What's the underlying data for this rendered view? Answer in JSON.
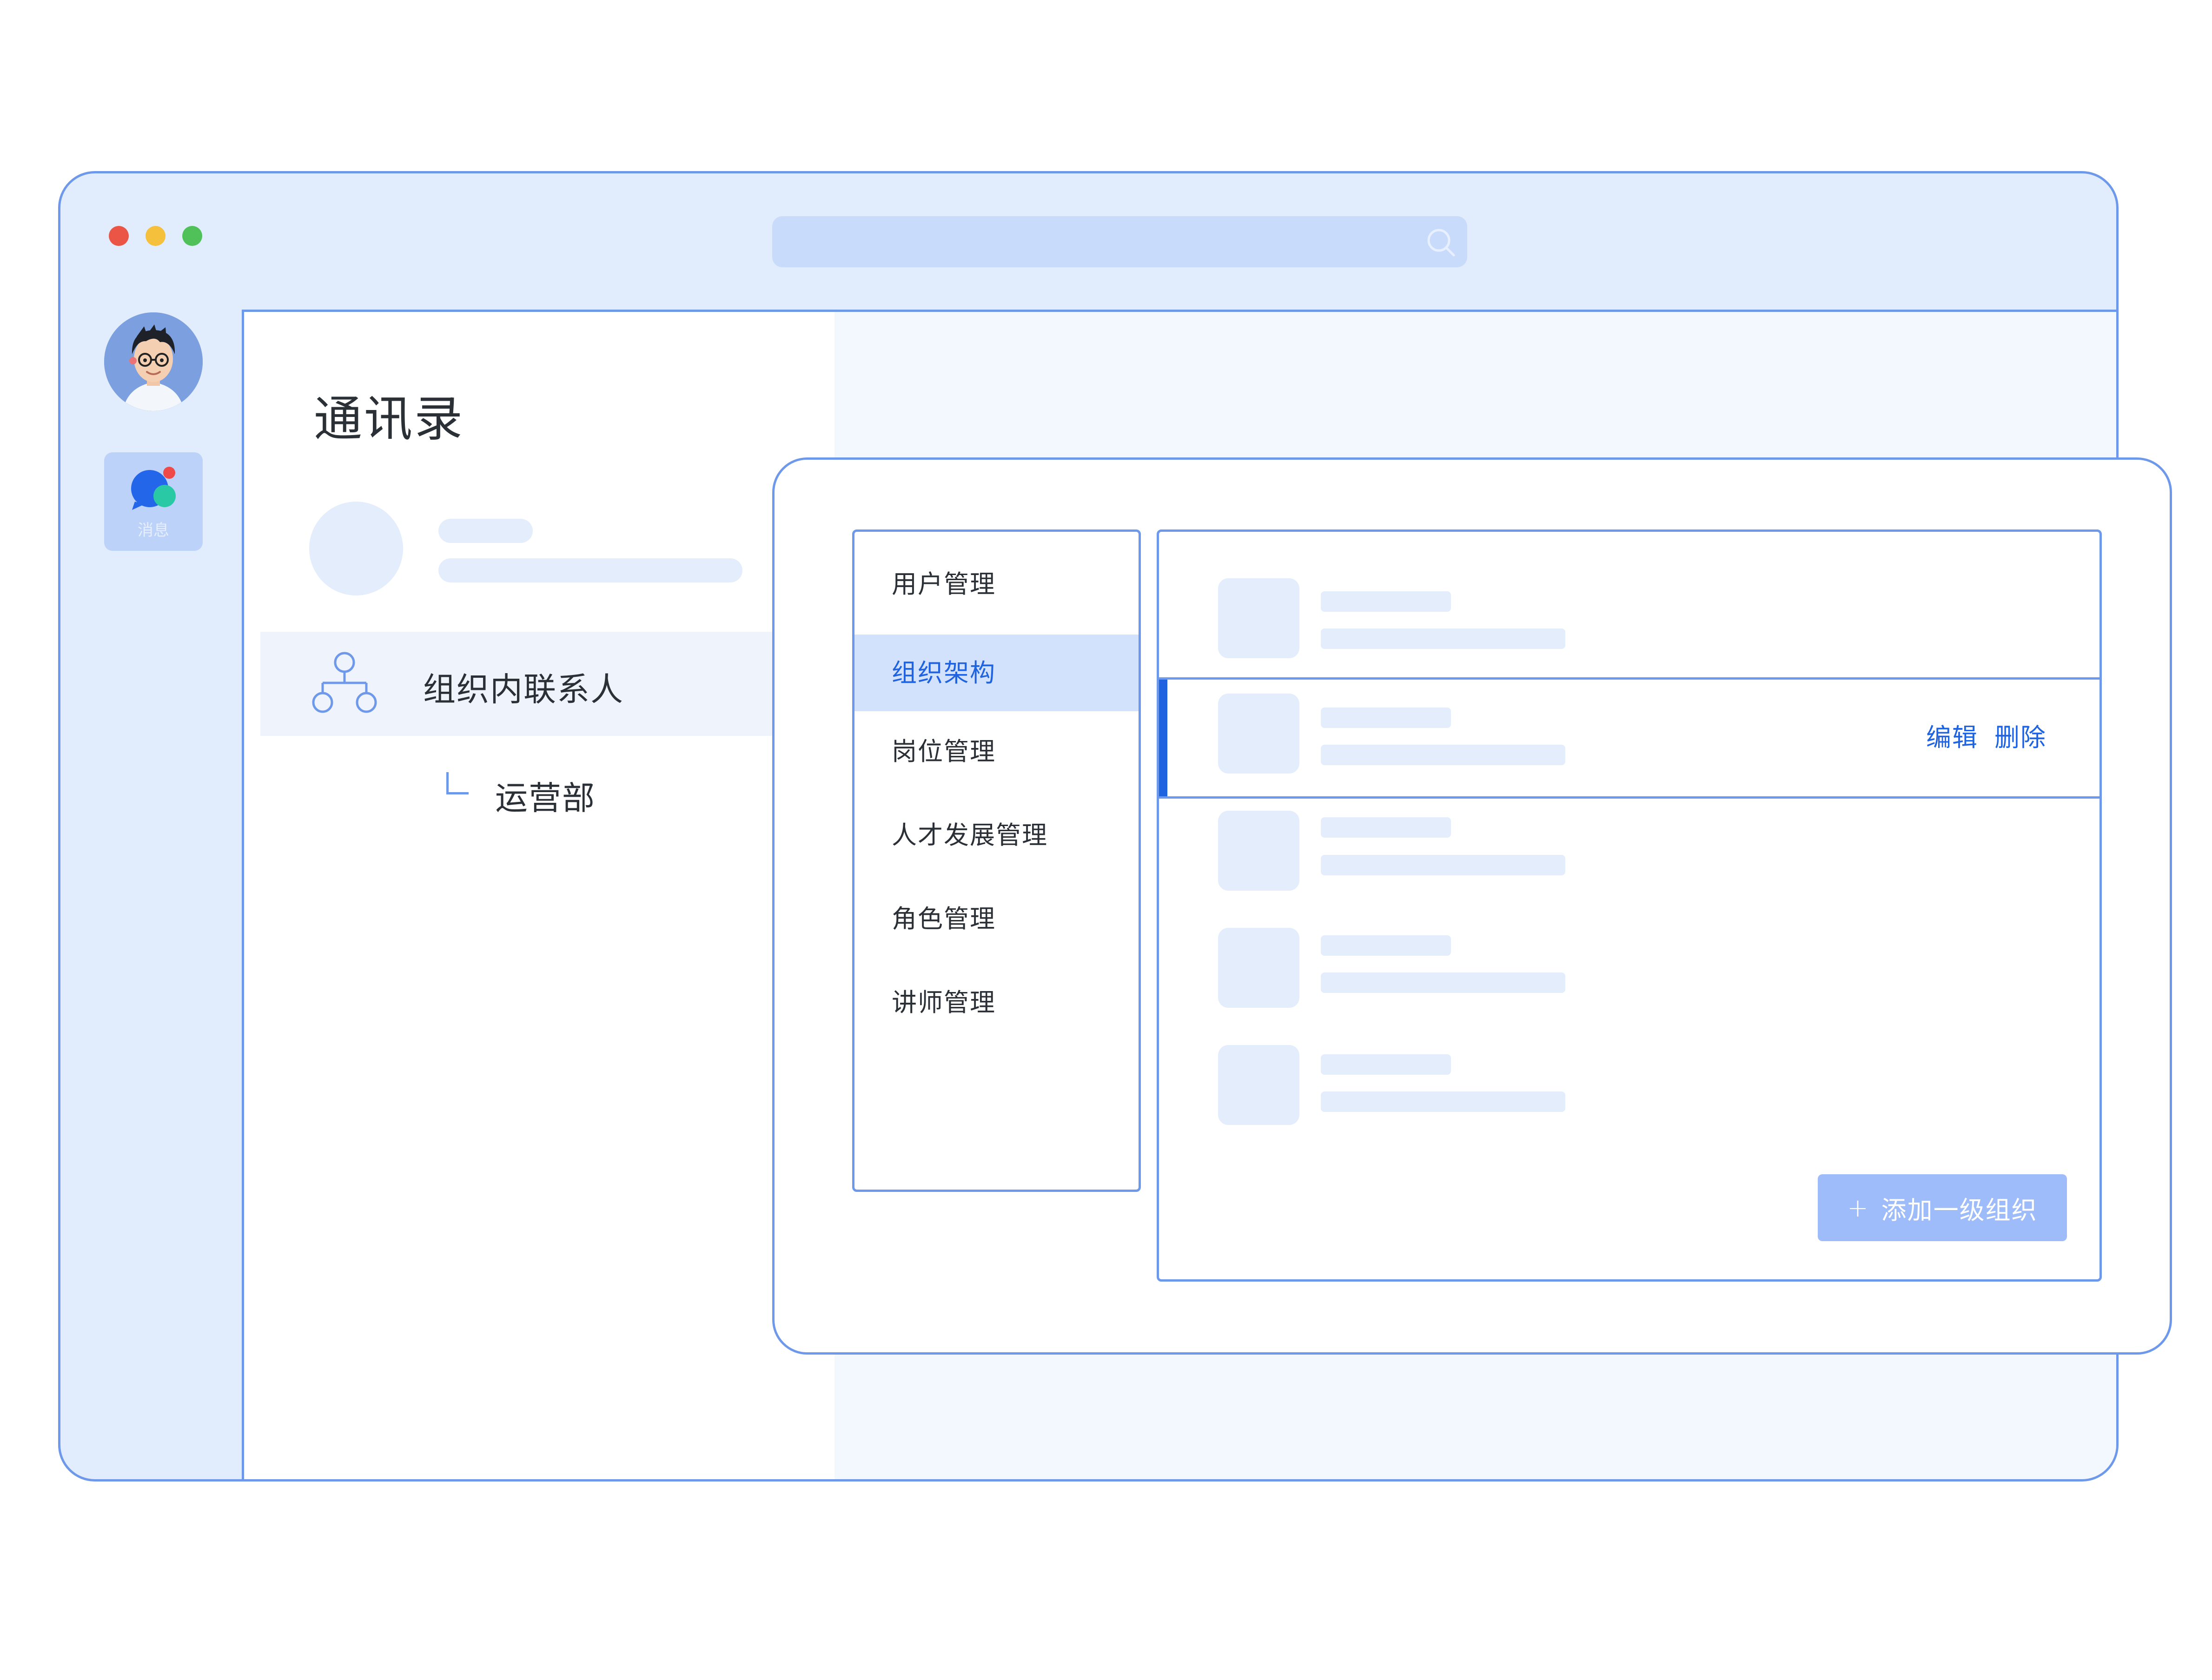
{
  "window": {
    "controls": [
      "close",
      "minimize",
      "zoom"
    ],
    "search_icon": "search-icon"
  },
  "sidebar": {
    "avatar": "user-avatar",
    "messages_label": "消息"
  },
  "contacts": {
    "title": "通讯录",
    "org_item_label": "组织内联系人",
    "sub_item_label": "运营部"
  },
  "menu": {
    "items": [
      {
        "label": "用户管理",
        "active": false
      },
      {
        "label": "组织架构",
        "active": true
      },
      {
        "label": "岗位管理",
        "active": false
      },
      {
        "label": "人才发展管理",
        "active": false
      },
      {
        "label": "角色管理",
        "active": false
      },
      {
        "label": "讲师管理",
        "active": false
      }
    ]
  },
  "org_list": {
    "row_count": 5,
    "active_row": 2,
    "edit_label": "编辑",
    "delete_label": "删除",
    "add_button_label": "添加一级组织",
    "add_button_icon": "plus-icon"
  },
  "colors": {
    "accent": "#1f63e0",
    "border": "#6e98ea",
    "window_bg": "#e1ecfd",
    "skeleton": "#e4edfc",
    "button_bg": "#9ebcfa",
    "dot_red": "#eb5545",
    "dot_yellow": "#f5c03b",
    "dot_green": "#4fc158"
  }
}
